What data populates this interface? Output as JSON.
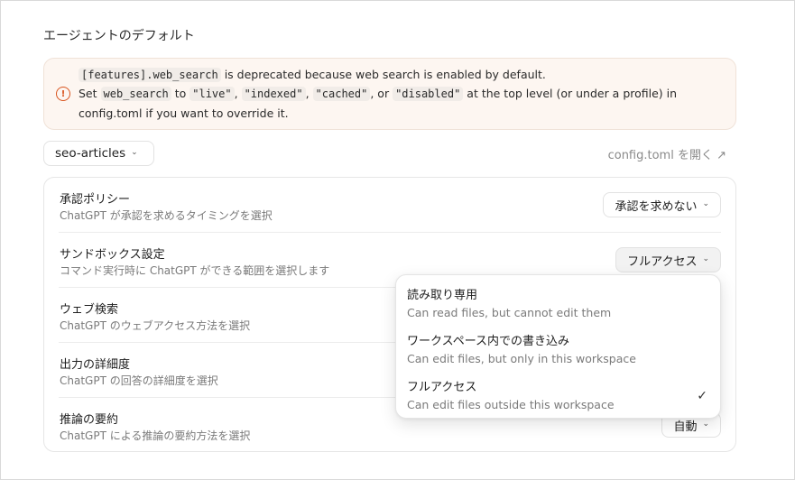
{
  "section_title": "エージェントのデフォルト",
  "notice": {
    "icon": "warning-circle-icon",
    "line1_code": "[features].web_search",
    "line1_text": " is deprecated because web search is enabled by default.",
    "line2_prefix": "Set ",
    "line2_code_key": "web_search",
    "line2_to": " to ",
    "opt_live": "\"live\"",
    "comma1": ", ",
    "opt_indexed": "\"indexed\"",
    "comma2": ", ",
    "opt_cached": "\"cached\"",
    "or": ", or ",
    "opt_disabled": "\"disabled\"",
    "line2_suffix": " at the top level (or under a profile) in",
    "line3": "config.toml if you want to override it."
  },
  "profile": {
    "label": "seo-articles"
  },
  "config_link": {
    "label": "config.toml を開く ↗"
  },
  "settings": [
    {
      "label": "承認ポリシー",
      "desc": "ChatGPT が承認を求めるタイミングを選択",
      "value": "承認を求めない"
    },
    {
      "label": "サンドボックス設定",
      "desc": "コマンド実行時に ChatGPT ができる範囲を選択します",
      "value": "フルアクセス"
    },
    {
      "label": "ウェブ検索",
      "desc": "ChatGPT のウェブアクセス方法を選択",
      "value": ""
    },
    {
      "label": "出力の詳細度",
      "desc": "ChatGPT の回答の詳細度を選択",
      "value": ""
    },
    {
      "label": "推論の要約",
      "desc": "ChatGPT による推論の要約方法を選択",
      "value": "自動"
    }
  ],
  "dropdown": {
    "options": [
      {
        "title": "読み取り専用",
        "desc": "Can read files, but cannot edit them",
        "selected": false
      },
      {
        "title": "ワークスペース内での書き込み",
        "desc": "Can edit files, but only in this workspace",
        "selected": false
      },
      {
        "title": "フルアクセス",
        "desc": "Can edit files outside this workspace",
        "selected": true
      }
    ],
    "check_glyph": "✓"
  },
  "colors": {
    "warning": "#d9541e",
    "notice_bg": "#fdf6f1"
  }
}
